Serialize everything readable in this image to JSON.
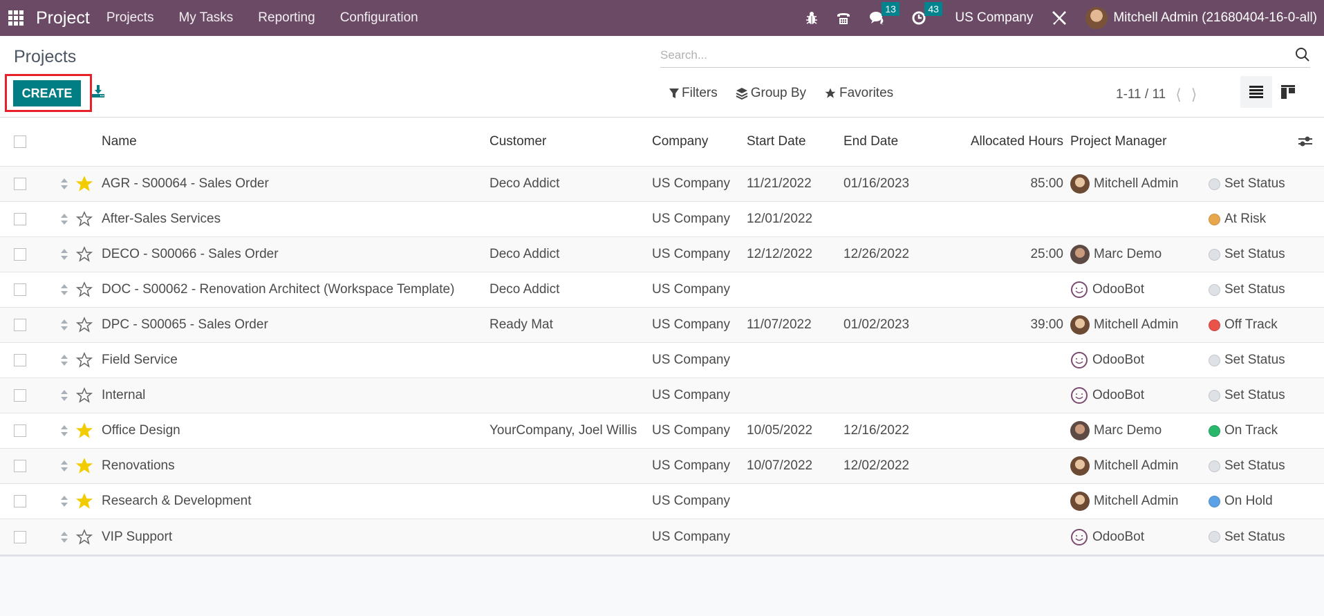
{
  "navbar": {
    "app_name": "Project",
    "menu": [
      "Projects",
      "My Tasks",
      "Reporting",
      "Configuration"
    ],
    "icons": {
      "debug": "bug-icon",
      "phone": "phone-icon",
      "chat": "chat-icon",
      "activity": "clock-icon",
      "settings": "tools-icon"
    },
    "messages_count": "13",
    "activities_count": "43",
    "company": "US Company",
    "user": "Mitchell Admin (21680404-16-0-all)"
  },
  "control": {
    "title": "Projects",
    "create_label": "CREATE",
    "search_placeholder": "Search...",
    "filters_label": "Filters",
    "groupby_label": "Group By",
    "favorites_label": "Favorites",
    "pager": "1-11 / 11"
  },
  "colors": {
    "navbar": "#6b4a65",
    "primary": "#017e84",
    "highlight_box": "#e8202a",
    "star_active": "#f3cc00",
    "status": {
      "Set Status": "#dee2e6",
      "At Risk": "#e8a64d",
      "Off Track": "#e9534a",
      "On Track": "#28b76b",
      "On Hold": "#5aa2e5"
    }
  },
  "table": {
    "columns": [
      "Name",
      "Customer",
      "Company",
      "Start Date",
      "End Date",
      "Allocated Hours",
      "Project Manager"
    ],
    "rows": [
      {
        "name": "AGR - S00064 - Sales Order",
        "favorite": true,
        "customer": "Deco Addict",
        "company": "US Company",
        "start": "11/21/2022",
        "end": "01/16/2023",
        "hours": "85:00",
        "manager": "Mitchell Admin",
        "avatar": "mitchell",
        "status": "Set Status"
      },
      {
        "name": "After-Sales Services",
        "favorite": false,
        "customer": "",
        "company": "US Company",
        "start": "12/01/2022",
        "end": "",
        "hours": "",
        "manager": "",
        "avatar": "",
        "status": "At Risk"
      },
      {
        "name": "DECO - S00066 - Sales Order",
        "favorite": false,
        "customer": "Deco Addict",
        "company": "US Company",
        "start": "12/12/2022",
        "end": "12/26/2022",
        "hours": "25:00",
        "manager": "Marc Demo",
        "avatar": "marc",
        "status": "Set Status"
      },
      {
        "name": "DOC - S00062 - Renovation Architect (Workspace Template)",
        "favorite": false,
        "customer": "Deco Addict",
        "company": "US Company",
        "start": "",
        "end": "",
        "hours": "",
        "manager": "OdooBot",
        "avatar": "bot",
        "status": "Set Status"
      },
      {
        "name": "DPC - S00065 - Sales Order",
        "favorite": false,
        "customer": "Ready Mat",
        "company": "US Company",
        "start": "11/07/2022",
        "end": "01/02/2023",
        "hours": "39:00",
        "manager": "Mitchell Admin",
        "avatar": "mitchell",
        "status": "Off Track"
      },
      {
        "name": "Field Service",
        "favorite": false,
        "customer": "",
        "company": "US Company",
        "start": "",
        "end": "",
        "hours": "",
        "manager": "OdooBot",
        "avatar": "bot",
        "status": "Set Status"
      },
      {
        "name": "Internal",
        "favorite": false,
        "customer": "",
        "company": "US Company",
        "start": "",
        "end": "",
        "hours": "",
        "manager": "OdooBot",
        "avatar": "bot",
        "status": "Set Status"
      },
      {
        "name": "Office Design",
        "favorite": true,
        "customer": "YourCompany, Joel Willis",
        "company": "US Company",
        "start": "10/05/2022",
        "end": "12/16/2022",
        "hours": "",
        "manager": "Marc Demo",
        "avatar": "marc",
        "status": "On Track"
      },
      {
        "name": "Renovations",
        "favorite": true,
        "customer": "",
        "company": "US Company",
        "start": "10/07/2022",
        "end": "12/02/2022",
        "hours": "",
        "manager": "Mitchell Admin",
        "avatar": "mitchell",
        "status": "Set Status"
      },
      {
        "name": "Research & Development",
        "favorite": true,
        "customer": "",
        "company": "US Company",
        "start": "",
        "end": "",
        "hours": "",
        "manager": "Mitchell Admin",
        "avatar": "mitchell",
        "status": "On Hold"
      },
      {
        "name": "VIP Support",
        "favorite": false,
        "customer": "",
        "company": "US Company",
        "start": "",
        "end": "",
        "hours": "",
        "manager": "OdooBot",
        "avatar": "bot",
        "status": "Set Status"
      }
    ]
  }
}
